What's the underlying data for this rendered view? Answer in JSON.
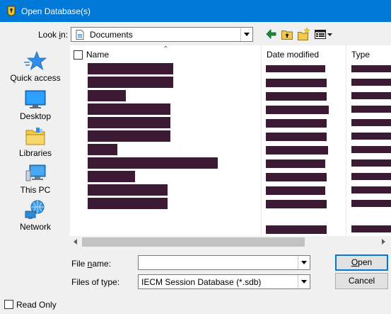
{
  "window": {
    "title": "Open Database(s)"
  },
  "toolbar": {
    "look_in_label_pre": "Look ",
    "look_in_label_mnemonic": "i",
    "look_in_label_post": "n:",
    "look_in_value": "Documents",
    "icons": [
      "back-arrow-icon",
      "up-folder-icon",
      "new-folder-icon",
      "view-menu-icon"
    ]
  },
  "places": [
    {
      "label": "Quick access",
      "icon": "quick-access-star-icon"
    },
    {
      "label": "Desktop",
      "icon": "desktop-icon"
    },
    {
      "label": "Libraries",
      "icon": "libraries-icon"
    },
    {
      "label": "This PC",
      "icon": "this-pc-icon"
    },
    {
      "label": "Network",
      "icon": "network-icon"
    }
  ],
  "file_list": {
    "columns": [
      "Name",
      "Date modified",
      "Type"
    ],
    "rows_redacted": 12,
    "redaction_color": "#3d1a34"
  },
  "form": {
    "file_name_label_pre": "File ",
    "file_name_label_mnemonic": "n",
    "file_name_label_post": "ame:",
    "file_name_value": "",
    "file_type_label": "Files of type:",
    "file_type_value": "IECM Session Database (*.sdb)"
  },
  "buttons": {
    "open_mnemonic": "O",
    "open_rest": "pen",
    "cancel": "Cancel"
  },
  "read_only": {
    "label": "Read Only",
    "checked": false
  },
  "colors": {
    "title_bar": "#0078d7",
    "dialog_bg": "#f0f0f0",
    "accent": "#0078d7"
  }
}
